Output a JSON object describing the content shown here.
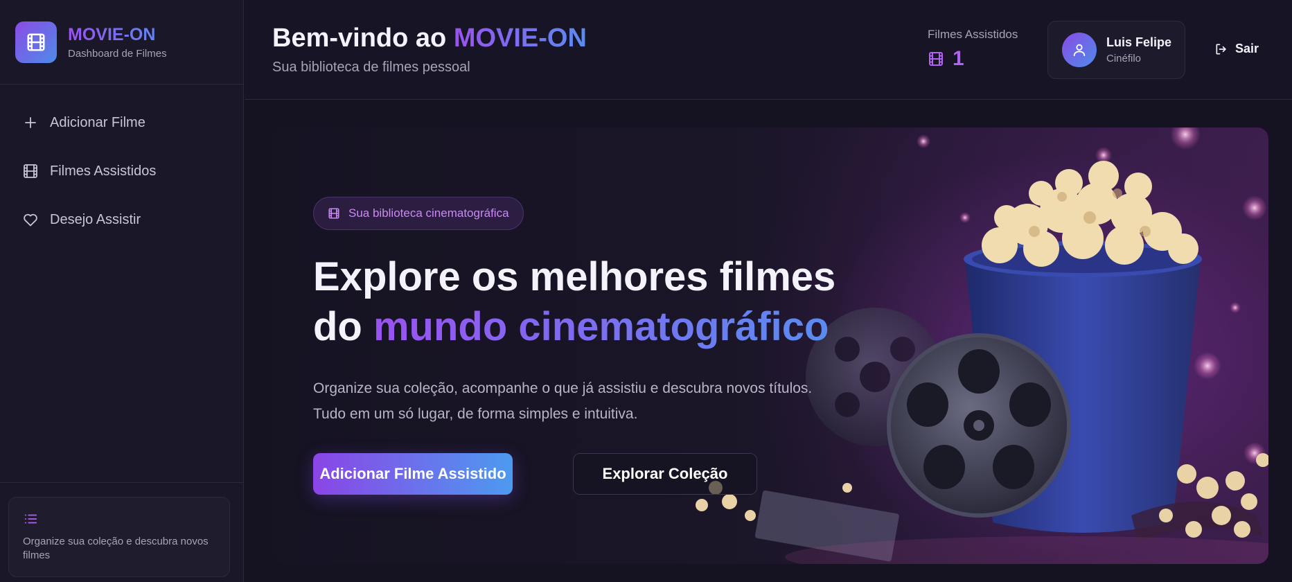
{
  "brand": {
    "name": "MOVIE-ON",
    "subtitle": "Dashboard de Filmes",
    "icon": "film-icon"
  },
  "sidebar": {
    "items": [
      {
        "label": "Adicionar Filme",
        "icon": "plus-icon"
      },
      {
        "label": "Filmes Assistidos",
        "icon": "film-icon"
      },
      {
        "label": "Desejo Assistir",
        "icon": "heart-icon"
      }
    ],
    "footer": {
      "icon": "list-icon",
      "text": "Organize sua coleção e descubra novos filmes"
    }
  },
  "header": {
    "welcome_prefix": "Bem-vindo ao ",
    "welcome_brand": "MOVIE-ON",
    "subtitle": "Sua biblioteca de filmes pessoal",
    "watched_label": "Filmes Assistidos",
    "watched_count": "1",
    "user": {
      "name": "Luis Felipe",
      "role": "Cinéfilo",
      "icon": "user-icon"
    },
    "logout_label": "Sair"
  },
  "hero": {
    "pill_label": "Sua biblioteca cinematográfica",
    "title_line1": "Explore os melhores filmes",
    "title_line2_plain": "do ",
    "title_line2_grad": "mundo cinematográfico",
    "desc_line1": "Organize sua coleção, acompanhe o que já assistiu e descubra novos títulos.",
    "desc_line2": "Tudo em um só lugar, de forma simples e intuitiva.",
    "primary_button": "Adicionar Filme Assistido",
    "secondary_button": "Explorar Coleção"
  },
  "colors": {
    "accent_purple": "#9a52f0",
    "accent_blue": "#5a8cf0",
    "background": "#151321"
  }
}
